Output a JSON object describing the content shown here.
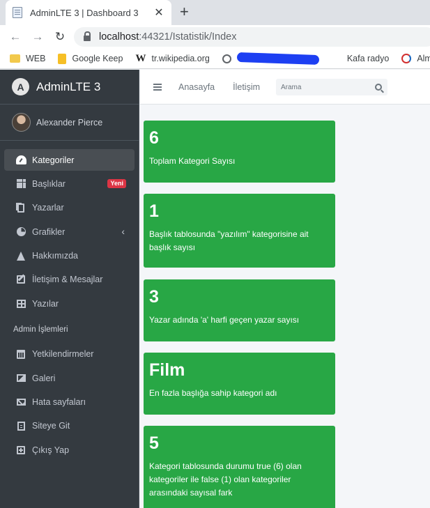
{
  "browser": {
    "tab_title": "AdminLTE 3 | Dashboard 3",
    "url_host": "localhost",
    "url_rest": ":44321/Istatistik/Index",
    "bookmarks": [
      "WEB",
      "Google Keep",
      "tr.wikipedia.org",
      "Kafa radyo",
      "Almanca"
    ]
  },
  "brand": {
    "title": "AdminLTE 3"
  },
  "user": {
    "name": "Alexander Pierce"
  },
  "sidebar": {
    "items": [
      {
        "label": "Kategoriler",
        "icon": "tachometer-icon"
      },
      {
        "label": "Başlıklar",
        "icon": "grid-icon",
        "badge": "Yeni"
      },
      {
        "label": "Yazarlar",
        "icon": "copy-icon"
      },
      {
        "label": "Grafikler",
        "icon": "pie-chart-icon"
      },
      {
        "label": "Hakkımızda",
        "icon": "tree-icon"
      },
      {
        "label": "İletişim & Mesajlar",
        "icon": "edit-icon"
      },
      {
        "label": "Yazılar",
        "icon": "table-icon"
      }
    ],
    "header": "Admin İşlemleri",
    "admin_items": [
      {
        "label": "Yetkilendirmeler",
        "icon": "calendar-icon"
      },
      {
        "label": "Galeri",
        "icon": "image-icon"
      },
      {
        "label": "Hata sayfaları",
        "icon": "envelope-icon"
      },
      {
        "label": "Siteye Git",
        "icon": "file-icon"
      },
      {
        "label": "Çıkış Yap",
        "icon": "plus-square-icon"
      }
    ]
  },
  "topnav": {
    "links": [
      "Anasayfa",
      "İletişim"
    ],
    "search_placeholder": "Arama"
  },
  "boxes": [
    {
      "value": "6",
      "desc": "Toplam Kategori Sayısı"
    },
    {
      "value": "1",
      "desc": "Başlık tablosunda \"yazılım\" kategorisine ait başlık sayısı"
    },
    {
      "value": "3",
      "desc": "Yazar adında 'a' harfi geçen yazar sayısı"
    },
    {
      "value": "Film",
      "desc": "En fazla başlığa sahip kategori adı"
    },
    {
      "value": "5",
      "desc": "Kategori tablosunda durumu true (6) olan kategoriler ile false (1) olan kategoriler arasındaki sayısal fark"
    }
  ],
  "colors": {
    "sidebar": "#343a40",
    "box": "#28a745",
    "badge": "#dc3545"
  }
}
